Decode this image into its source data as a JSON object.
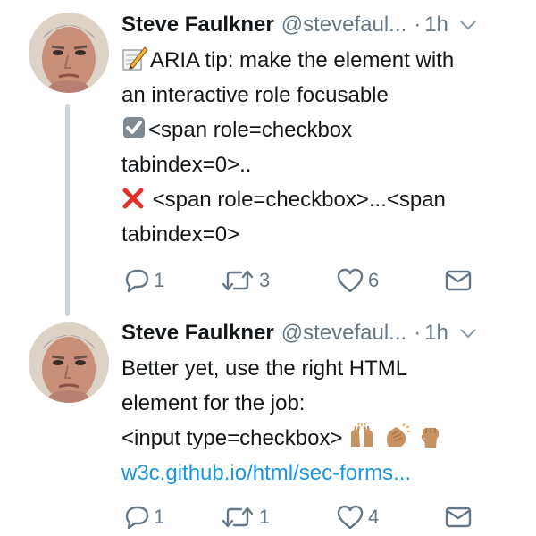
{
  "tweets": [
    {
      "name": "Steve Faulkner",
      "handle": "@stevefaul...",
      "dot": "·",
      "time": "1h",
      "lines": [
        {
          "emoji": "memo",
          "text": "ARIA tip: make the element with"
        },
        {
          "text": "an interactive role focusable"
        },
        {
          "emoji": "check-box",
          "text": "<span role=checkbox"
        },
        {
          "text": "tabindex=0>.."
        },
        {
          "emoji": "cross-mark",
          "text": " <span role=checkbox>...<span"
        },
        {
          "text": "tabindex=0>"
        }
      ],
      "actions": {
        "replies": "1",
        "retweets": "3",
        "likes": "6"
      }
    },
    {
      "name": "Steve Faulkner",
      "handle": "@stevefaul...",
      "dot": "·",
      "time": "1h",
      "lines": [
        {
          "text": "Better yet, use the right HTML"
        },
        {
          "text": "element for the job:"
        },
        {
          "text": "<input type=checkbox>",
          "emoji_after": [
            "raising-hands",
            "clapping-hands",
            "raised-fist"
          ]
        },
        {
          "text": "w3c.github.io/html/sec-forms...",
          "link": true
        }
      ],
      "actions": {
        "replies": "1",
        "retweets": "1",
        "likes": "4"
      }
    }
  ],
  "icons": {
    "reply": "reply-icon",
    "retweet": "retweet-icon",
    "like": "heart-icon",
    "dm": "direct-message-icon",
    "menu": "chevron-down-icon"
  },
  "colors": {
    "text": "#14171a",
    "muted": "#657786",
    "link": "#1b95e0",
    "thread_line": "#ccd6dd",
    "cross": "#e0322a",
    "check_box": "#7d8a93",
    "emoji_skin": "#c79362"
  }
}
